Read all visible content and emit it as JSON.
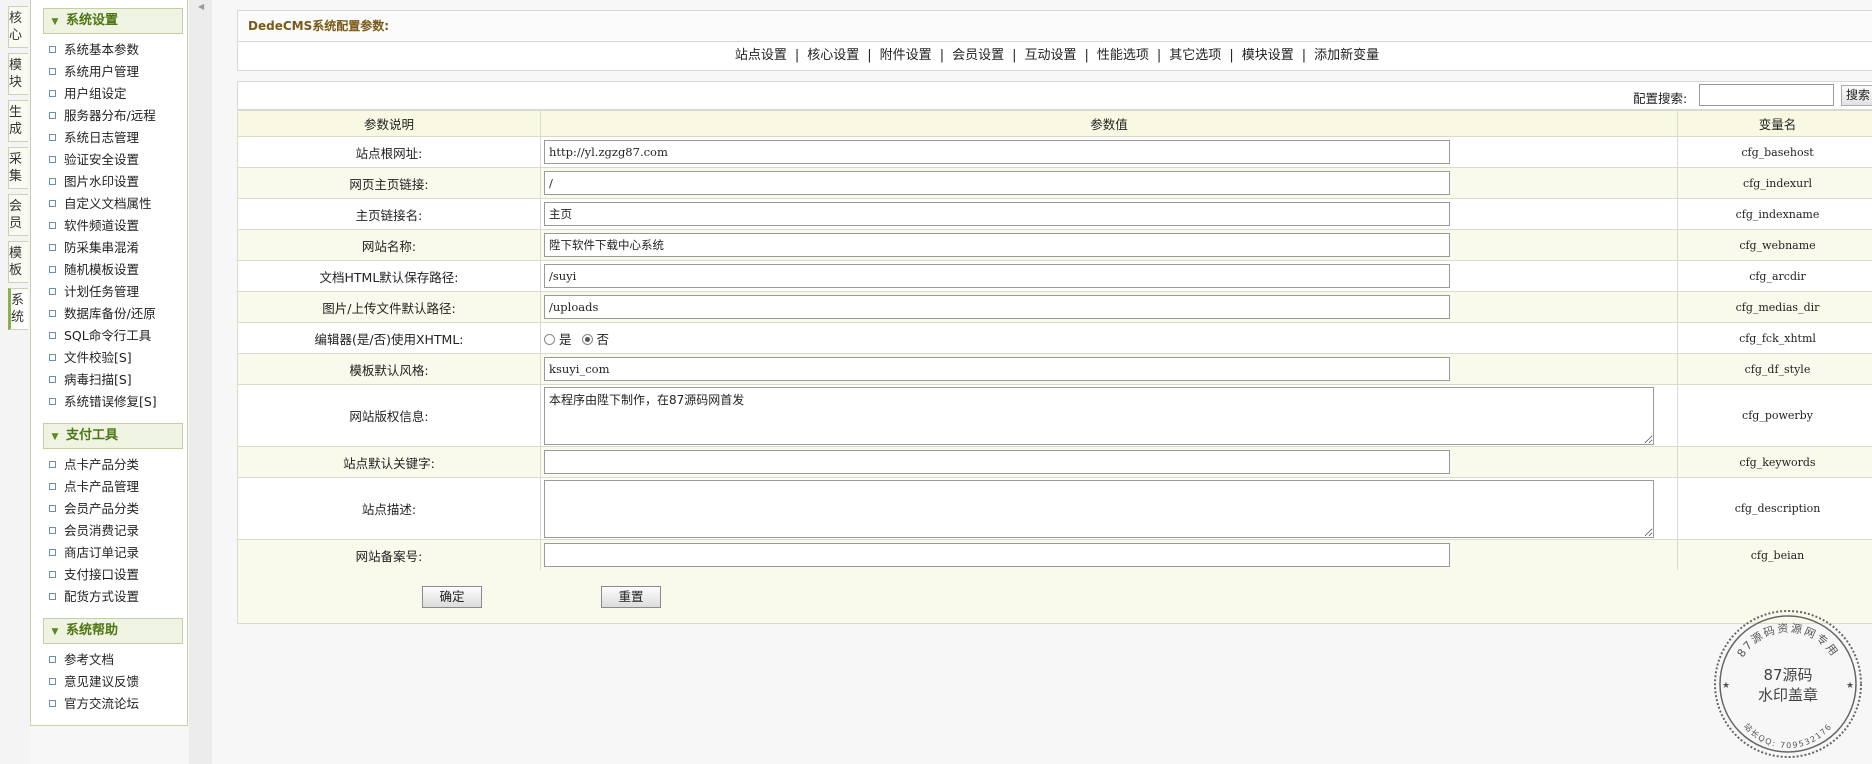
{
  "vtabs": [
    {
      "label": "核心",
      "active": false
    },
    {
      "label": "模块",
      "active": false
    },
    {
      "label": "生成",
      "active": false
    },
    {
      "label": "采集",
      "active": false
    },
    {
      "label": "会员",
      "active": false
    },
    {
      "label": "模板",
      "active": false
    },
    {
      "label": "系统",
      "active": true
    }
  ],
  "menu": {
    "sections": [
      {
        "title": "系统设置",
        "items": [
          "系统基本参数",
          "系统用户管理",
          "用户组设定",
          "服务器分布/远程",
          "系统日志管理",
          "验证安全设置",
          "图片水印设置",
          "自定义文档属性",
          "软件频道设置",
          "防采集串混淆",
          "随机模板设置",
          "计划任务管理",
          "数据库备份/还原",
          "SQL命令行工具",
          "文件校验[S]",
          "病毒扫描[S]",
          "系统错误修复[S]"
        ]
      },
      {
        "title": "支付工具",
        "items": [
          "点卡产品分类",
          "点卡产品管理",
          "会员产品分类",
          "会员消费记录",
          "商店订单记录",
          "支付接口设置",
          "配货方式设置"
        ]
      },
      {
        "title": "系统帮助",
        "items": [
          "参考文档",
          "意见建议反馈",
          "官方交流论坛"
        ]
      }
    ]
  },
  "main": {
    "title": "DedeCMS系统配置参数:",
    "tabs": [
      "站点设置",
      "核心设置",
      "附件设置",
      "会员设置",
      "互动设置",
      "性能选项",
      "其它选项",
      "模块设置",
      "添加新变量"
    ],
    "search": {
      "label": "配置搜索:",
      "value": "",
      "button": "搜索"
    },
    "table": {
      "headers": [
        "参数说明",
        "参数值",
        "变量名"
      ],
      "rows": [
        {
          "label": "站点根网址:",
          "type": "text",
          "value": "http://yl.zgzg87.com",
          "var": "cfg_basehost"
        },
        {
          "label": "网页主页链接:",
          "type": "text",
          "value": "/",
          "var": "cfg_indexurl"
        },
        {
          "label": "主页链接名:",
          "type": "text",
          "value": "主页",
          "var": "cfg_indexname"
        },
        {
          "label": "网站名称:",
          "type": "text",
          "value": "陞下软件下载中心系统",
          "var": "cfg_webname"
        },
        {
          "label": "文档HTML默认保存路径:",
          "type": "text",
          "value": "/suyi",
          "var": "cfg_arcdir"
        },
        {
          "label": "图片/上传文件默认路径:",
          "type": "text",
          "value": "/uploads",
          "var": "cfg_medias_dir"
        },
        {
          "label": "编辑器(是/否)使用XHTML:",
          "type": "radio",
          "options": [
            {
              "label": "是",
              "checked": false
            },
            {
              "label": "否",
              "checked": true
            }
          ],
          "var": "cfg_fck_xhtml"
        },
        {
          "label": "模板默认风格:",
          "type": "text",
          "value": "ksuyi_com",
          "var": "cfg_df_style"
        },
        {
          "label": "网站版权信息:",
          "type": "textarea",
          "value": "本程序由陞下制作，在87源码网首发",
          "var": "cfg_powerby"
        },
        {
          "label": "站点默认关键字:",
          "type": "text",
          "value": "",
          "var": "cfg_keywords"
        },
        {
          "label": "站点描述:",
          "type": "textarea",
          "value": "",
          "var": "cfg_description"
        },
        {
          "label": "网站备案号:",
          "type": "text",
          "value": "",
          "var": "cfg_beian"
        }
      ]
    },
    "buttons": {
      "confirm": "确定",
      "reset": "重置"
    }
  },
  "watermark": {
    "arc_top": "87源码资源网专用",
    "line1": "87源码",
    "line2": "水印盖章",
    "arc_bottom": "站长QQ: 709532176",
    "color": "#555555"
  }
}
